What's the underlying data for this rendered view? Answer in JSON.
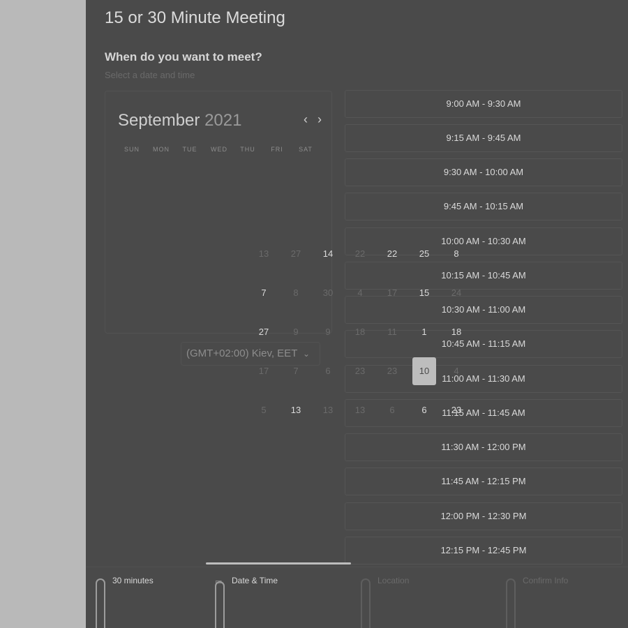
{
  "page": {
    "title": "15 or 30 Minute Meeting",
    "question": "When do you want to meet?",
    "subtitle": "Select a date and time"
  },
  "calendar": {
    "month": "September",
    "year": "2021",
    "weekdays": [
      "SUN",
      "MON",
      "TUE",
      "WED",
      "THU",
      "FRI",
      "SAT"
    ],
    "selected_day": "10"
  },
  "day_overlay": [
    [
      "13",
      "27",
      "14",
      "22",
      "22",
      "25",
      "8"
    ],
    [
      "7",
      "8",
      "30",
      "4",
      "17",
      "15",
      "24"
    ],
    [
      "27",
      "9",
      "9",
      "18",
      "11",
      "1",
      "18"
    ],
    [
      "17",
      "7",
      "6",
      "23",
      "23",
      "10",
      "4"
    ],
    [
      "5",
      "13",
      "13",
      "13",
      "6",
      "6",
      "23"
    ]
  ],
  "timezone": {
    "value": "(GMT+02:00) Kiev, EET"
  },
  "time_slots": [
    "9:00 AM - 9:30 AM",
    "9:15 AM - 9:45 AM",
    "9:30 AM - 10:00 AM",
    "9:45 AM - 10:15 AM",
    "10:00 AM - 10:30 AM",
    "10:15 AM - 10:45 AM",
    "10:30 AM - 11:00 AM",
    "10:45 AM - 11:15 AM",
    "11:00 AM - 11:30 AM",
    "11:15 AM - 11:45 AM",
    "11:30 AM - 12:00 PM",
    "11:45 AM - 12:15 PM",
    "12:00 PM - 12:30 PM",
    "12:15 PM - 12:45 PM"
  ],
  "steps": [
    {
      "label": "30 minutes",
      "active": true
    },
    {
      "label": "Date & Time",
      "active": true
    },
    {
      "label": "Location",
      "active": false
    },
    {
      "label": "Confirm Info",
      "active": false
    }
  ],
  "colors": {
    "panel_bg": "#4a4a4a",
    "backdrop": "#b9b9b9",
    "selected_day_bg": "#bdbdbd"
  }
}
